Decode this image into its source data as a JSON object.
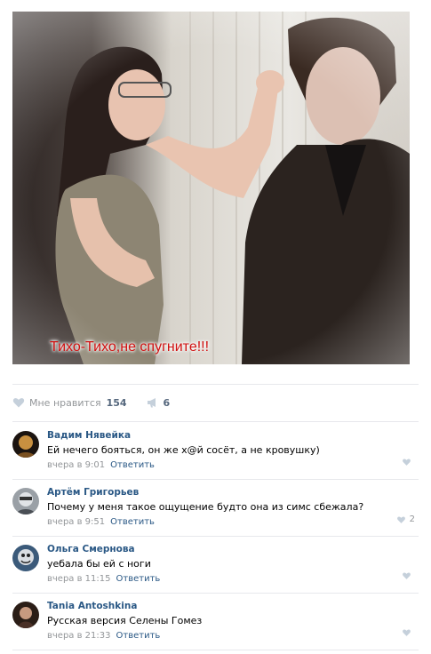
{
  "post": {
    "image_caption": "Тихо-Тихо,не спугните!!!",
    "likes_label": "Мне нравится",
    "likes_count": "154",
    "shares_count": "6"
  },
  "comments": [
    {
      "author": "Вадим Нявейка",
      "text": "Ей нечего бояться, он же х@й сосёт, а не кровушку)",
      "time": "вчера в 9:01",
      "reply_label": "Ответить",
      "like_count": ""
    },
    {
      "author": "Артём Григорьев",
      "text": "Почему у меня такое ощущение будто она из симс сбежала?",
      "time": "вчера в 9:51",
      "reply_label": "Ответить",
      "like_count": "2"
    },
    {
      "author": "Ольга Смернова",
      "text": "уебала бы ей с ноги",
      "time": "вчера в 11:15",
      "reply_label": "Ответить",
      "like_count": ""
    },
    {
      "author": "Tania Antoshkina",
      "text": "Русская версия Селены Гомез",
      "time": "вчера в 21:33",
      "reply_label": "Ответить",
      "like_count": ""
    }
  ],
  "icons": {
    "like": "heart-icon",
    "share": "megaphone-icon",
    "comment_like": "heart-icon"
  },
  "colors": {
    "link": "#2a5885",
    "muted": "#939699",
    "caption": "#d01010",
    "icon": "#c5d0db"
  }
}
